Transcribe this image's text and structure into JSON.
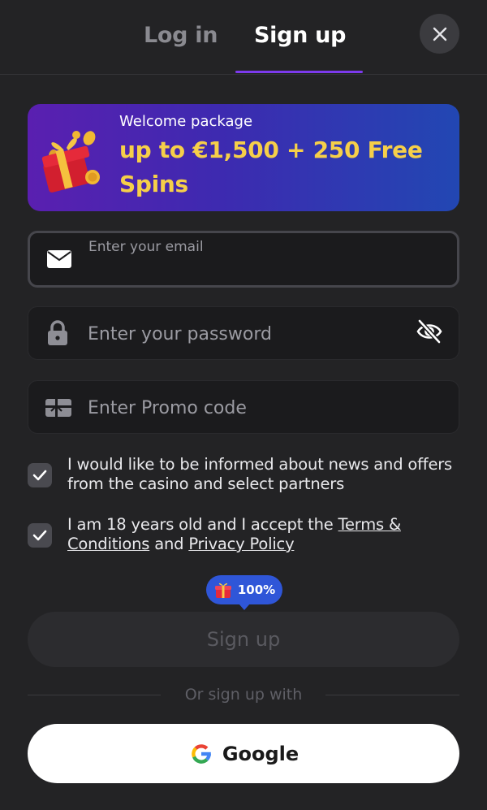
{
  "tabs": {
    "login_label": "Log in",
    "signup_label": "Sign up",
    "active": "signup"
  },
  "banner": {
    "subtitle": "Welcome package",
    "title": "up to €1,500 + 250 Free Spins"
  },
  "form": {
    "email": {
      "label": "Enter your email",
      "value": ""
    },
    "password": {
      "placeholder": "Enter your password",
      "value": ""
    },
    "promo": {
      "placeholder": "Enter Promo code",
      "value": ""
    }
  },
  "consents": {
    "news": {
      "text": "I would like to be informed about news and offers from the casino and select partners",
      "checked": true
    },
    "terms": {
      "prefix": "I am 18 years old and I accept the ",
      "terms_link": "Terms & Conditions",
      "middle": " and ",
      "privacy_link": "Privacy Policy",
      "checked": true
    }
  },
  "bonus_badge": {
    "text": "100%",
    "icon": "gift-icon"
  },
  "signup_button": {
    "label": "Sign up",
    "enabled": false
  },
  "divider": {
    "text": "Or sign up with"
  },
  "google_button": {
    "label": "Google",
    "icon": "google-icon"
  },
  "colors": {
    "background": "#232325",
    "accent_purple": "#7c3aed",
    "banner_gold": "#f6cf49",
    "badge_blue": "#2f56d8"
  }
}
